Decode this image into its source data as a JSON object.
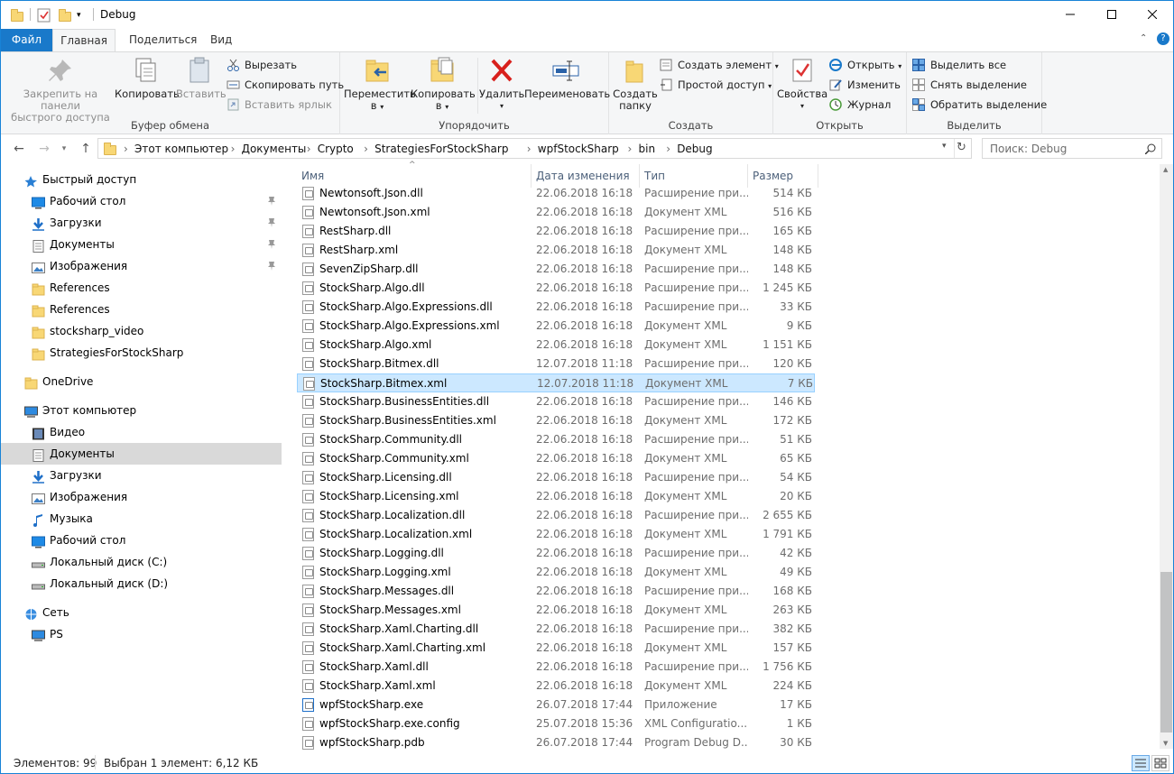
{
  "window": {
    "title": "Debug"
  },
  "tabs": {
    "file": "Файл",
    "home": "Главная",
    "share": "Поделиться",
    "view": "Вид"
  },
  "ribbon": {
    "clipboard": {
      "label": "Буфер обмена",
      "pin": "Закрепить на панели быстрого доступа",
      "pin1": "Закрепить на панели",
      "pin2": "быстрого доступа",
      "copy": "Копировать",
      "paste": "Вставить",
      "cut": "Вырезать",
      "copy_path": "Скопировать путь",
      "paste_shortcut": "Вставить ярлык"
    },
    "organize": {
      "label": "Упорядочить",
      "move1": "Переместить",
      "move2": "в",
      "copy1": "Копировать",
      "copy2": "в",
      "delete": "Удалить",
      "rename": "Переименовать"
    },
    "create": {
      "label": "Создать",
      "new_folder1": "Создать",
      "new_folder2": "папку",
      "new_item": "Создать элемент",
      "easy_access": "Простой доступ"
    },
    "open": {
      "label": "Открыть",
      "properties": "Свойства",
      "open": "Открыть",
      "edit": "Изменить",
      "history": "Журнал"
    },
    "select": {
      "label": "Выделить",
      "all": "Выделить все",
      "none": "Снять выделение",
      "invert": "Обратить выделение"
    }
  },
  "address": {
    "crumbs": [
      "Этот компьютер",
      "Документы",
      "Crypto",
      "StrategiesForStockSharp",
      "wpfStockSharp",
      "bin",
      "Debug"
    ],
    "search_placeholder": "Поиск: Debug"
  },
  "nav": [
    {
      "label": "Быстрый доступ",
      "icon": "star-icon",
      "level": 0
    },
    {
      "label": "Рабочий стол",
      "icon": "desktop-icon",
      "level": 1,
      "pinned": true
    },
    {
      "label": "Загрузки",
      "icon": "download-icon",
      "level": 1,
      "pinned": true
    },
    {
      "label": "Документы",
      "icon": "documents-icon",
      "level": 1,
      "pinned": true
    },
    {
      "label": "Изображения",
      "icon": "pictures-icon",
      "level": 1,
      "pinned": true
    },
    {
      "label": "References",
      "icon": "folder-icon",
      "level": 1
    },
    {
      "label": "References",
      "icon": "folder-icon",
      "level": 1
    },
    {
      "label": "stocksharp_video",
      "icon": "folder-icon",
      "level": 1
    },
    {
      "label": "StrategiesForStockSharp",
      "icon": "folder-icon",
      "level": 1
    },
    {
      "label": "OneDrive",
      "icon": "onedrive-icon",
      "level": 0,
      "gap": true
    },
    {
      "label": "Этот компьютер",
      "icon": "computer-icon",
      "level": 0,
      "gap": true
    },
    {
      "label": "Видео",
      "icon": "video-icon",
      "level": 1
    },
    {
      "label": "Документы",
      "icon": "documents-icon",
      "level": 1,
      "selected": true
    },
    {
      "label": "Загрузки",
      "icon": "download-icon",
      "level": 1
    },
    {
      "label": "Изображения",
      "icon": "pictures-icon",
      "level": 1
    },
    {
      "label": "Музыка",
      "icon": "music-icon",
      "level": 1
    },
    {
      "label": "Рабочий стол",
      "icon": "desktop-icon",
      "level": 1
    },
    {
      "label": "Локальный диск (C:)",
      "icon": "drive-icon",
      "level": 1
    },
    {
      "label": "Локальный диск (D:)",
      "icon": "drive-icon",
      "level": 1
    },
    {
      "label": "Сеть",
      "icon": "network-icon",
      "level": 0,
      "gap": true
    },
    {
      "label": "PS",
      "icon": "computer-icon",
      "level": 1
    }
  ],
  "columns": {
    "name": "Имя",
    "date": "Дата изменения",
    "type": "Тип",
    "size": "Размер"
  },
  "files": [
    {
      "name": "Newtonsoft.Json.dll",
      "date": "22.06.2018 16:18",
      "type": "Расширение при...",
      "size": "514 КБ"
    },
    {
      "name": "Newtonsoft.Json.xml",
      "date": "22.06.2018 16:18",
      "type": "Документ XML",
      "size": "516 КБ"
    },
    {
      "name": "RestSharp.dll",
      "date": "22.06.2018 16:18",
      "type": "Расширение при...",
      "size": "165 КБ"
    },
    {
      "name": "RestSharp.xml",
      "date": "22.06.2018 16:18",
      "type": "Документ XML",
      "size": "148 КБ"
    },
    {
      "name": "SevenZipSharp.dll",
      "date": "22.06.2018 16:18",
      "type": "Расширение при...",
      "size": "148 КБ"
    },
    {
      "name": "StockSharp.Algo.dll",
      "date": "22.06.2018 16:18",
      "type": "Расширение при...",
      "size": "1 245 КБ"
    },
    {
      "name": "StockSharp.Algo.Expressions.dll",
      "date": "22.06.2018 16:18",
      "type": "Расширение при...",
      "size": "33 КБ"
    },
    {
      "name": "StockSharp.Algo.Expressions.xml",
      "date": "22.06.2018 16:18",
      "type": "Документ XML",
      "size": "9 КБ"
    },
    {
      "name": "StockSharp.Algo.xml",
      "date": "22.06.2018 16:18",
      "type": "Документ XML",
      "size": "1 151 КБ"
    },
    {
      "name": "StockSharp.Bitmex.dll",
      "date": "12.07.2018 11:18",
      "type": "Расширение при...",
      "size": "120 КБ"
    },
    {
      "name": "StockSharp.Bitmex.xml",
      "date": "12.07.2018 11:18",
      "type": "Документ XML",
      "size": "7 КБ",
      "selected": true
    },
    {
      "name": "StockSharp.BusinessEntities.dll",
      "date": "22.06.2018 16:18",
      "type": "Расширение при...",
      "size": "146 КБ"
    },
    {
      "name": "StockSharp.BusinessEntities.xml",
      "date": "22.06.2018 16:18",
      "type": "Документ XML",
      "size": "172 КБ"
    },
    {
      "name": "StockSharp.Community.dll",
      "date": "22.06.2018 16:18",
      "type": "Расширение при...",
      "size": "51 КБ"
    },
    {
      "name": "StockSharp.Community.xml",
      "date": "22.06.2018 16:18",
      "type": "Документ XML",
      "size": "65 КБ"
    },
    {
      "name": "StockSharp.Licensing.dll",
      "date": "22.06.2018 16:18",
      "type": "Расширение при...",
      "size": "54 КБ"
    },
    {
      "name": "StockSharp.Licensing.xml",
      "date": "22.06.2018 16:18",
      "type": "Документ XML",
      "size": "20 КБ"
    },
    {
      "name": "StockSharp.Localization.dll",
      "date": "22.06.2018 16:18",
      "type": "Расширение при...",
      "size": "2 655 КБ"
    },
    {
      "name": "StockSharp.Localization.xml",
      "date": "22.06.2018 16:18",
      "type": "Документ XML",
      "size": "1 791 КБ"
    },
    {
      "name": "StockSharp.Logging.dll",
      "date": "22.06.2018 16:18",
      "type": "Расширение при...",
      "size": "42 КБ"
    },
    {
      "name": "StockSharp.Logging.xml",
      "date": "22.06.2018 16:18",
      "type": "Документ XML",
      "size": "49 КБ"
    },
    {
      "name": "StockSharp.Messages.dll",
      "date": "22.06.2018 16:18",
      "type": "Расширение при...",
      "size": "168 КБ"
    },
    {
      "name": "StockSharp.Messages.xml",
      "date": "22.06.2018 16:18",
      "type": "Документ XML",
      "size": "263 КБ"
    },
    {
      "name": "StockSharp.Xaml.Charting.dll",
      "date": "22.06.2018 16:18",
      "type": "Расширение при...",
      "size": "382 КБ"
    },
    {
      "name": "StockSharp.Xaml.Charting.xml",
      "date": "22.06.2018 16:18",
      "type": "Документ XML",
      "size": "157 КБ"
    },
    {
      "name": "StockSharp.Xaml.dll",
      "date": "22.06.2018 16:18",
      "type": "Расширение при...",
      "size": "1 756 КБ"
    },
    {
      "name": "StockSharp.Xaml.xml",
      "date": "22.06.2018 16:18",
      "type": "Документ XML",
      "size": "224 КБ"
    },
    {
      "name": "wpfStockSharp.exe",
      "date": "26.07.2018 17:44",
      "type": "Приложение",
      "size": "17 КБ"
    },
    {
      "name": "wpfStockSharp.exe.config",
      "date": "25.07.2018 15:36",
      "type": "XML Configuratio...",
      "size": "1 КБ"
    },
    {
      "name": "wpfStockSharp.pdb",
      "date": "26.07.2018 17:44",
      "type": "Program Debug D...",
      "size": "30 КБ"
    }
  ],
  "status": {
    "count": "Элементов: 99",
    "selected": "Выбран 1 элемент: 6,12 КБ"
  }
}
